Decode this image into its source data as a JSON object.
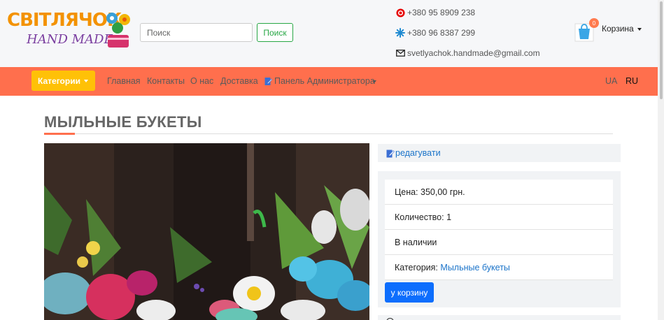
{
  "logo": {
    "line1": "СВІТЛЯЧОК",
    "line2": "HAND MADE"
  },
  "search": {
    "placeholder": "Поиск",
    "button_label": "Поиск"
  },
  "contacts": {
    "phone_vodafone": "+380 95 8909 238",
    "phone_kyivstar": "+380 96 8387 299",
    "email": "svetlyachok.handmade@gmail.com"
  },
  "cart": {
    "label": "Корзина",
    "count": "0"
  },
  "nav": {
    "categories_label": "Категории",
    "links": [
      "Главная",
      "Контакты",
      "О нас",
      "Доставка"
    ],
    "admin_label": "Панель Администратора",
    "lang_ua": "UA",
    "lang_ru": "RU"
  },
  "product": {
    "title": "МЫЛЬНЫЕ БУКЕТЫ",
    "edit_label": "редагувати",
    "price": "Цена: 350,00 грн.",
    "quantity": "Количество: 1",
    "availability": "В наличии",
    "category_label": "Категория:",
    "category_value": "Мыльные букеты",
    "add_to_cart": "у корзину"
  },
  "colors": {
    "navbar": "#ff6f4d",
    "categories_button": "#ffc107",
    "search_button": "#28a745",
    "add_to_cart_button": "#0d6efd",
    "link": "#1a73c9"
  }
}
